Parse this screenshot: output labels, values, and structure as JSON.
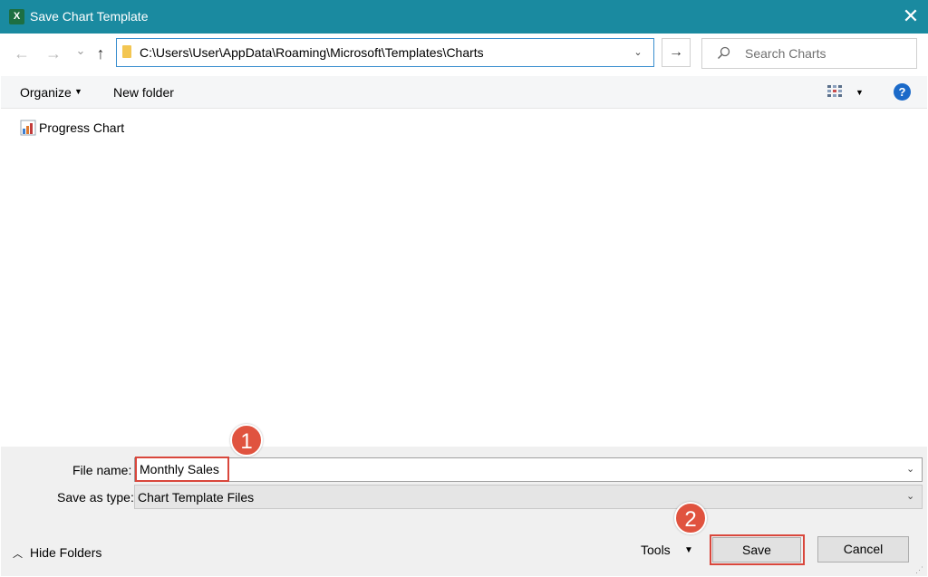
{
  "window": {
    "title": "Save Chart Template",
    "app_icon_letter": "X",
    "close_glyph": "✕"
  },
  "navigation": {
    "back_glyph": "←",
    "forward_glyph": "→",
    "recent_glyph": "⌄",
    "up_glyph": "↑",
    "address_path": "C:\\Users\\User\\AppData\\Roaming\\Microsoft\\Templates\\Charts",
    "address_dropdown_glyph": "⌄",
    "go_glyph": "→",
    "search_placeholder": "Search Charts"
  },
  "commandbar": {
    "organize_label": "Organize",
    "new_folder_label": "New folder",
    "help_glyph": "?"
  },
  "files": [
    {
      "name": "Progress Chart",
      "icon": "chart-template-icon"
    }
  ],
  "form": {
    "file_name_label": "File name:",
    "file_name_value": "Monthly Sales",
    "save_type_label": "Save as type:",
    "save_type_value": "Chart Template Files"
  },
  "footer": {
    "hide_folders_label": "Hide Folders",
    "tools_label": "Tools",
    "save_label": "Save",
    "cancel_label": "Cancel"
  },
  "annotations": [
    {
      "number": "1"
    },
    {
      "number": "2"
    }
  ],
  "colors": {
    "titlebar": "#1a8aa0",
    "highlight": "#d9473c",
    "marker": "#e0533f",
    "help": "#1b6ac9"
  }
}
